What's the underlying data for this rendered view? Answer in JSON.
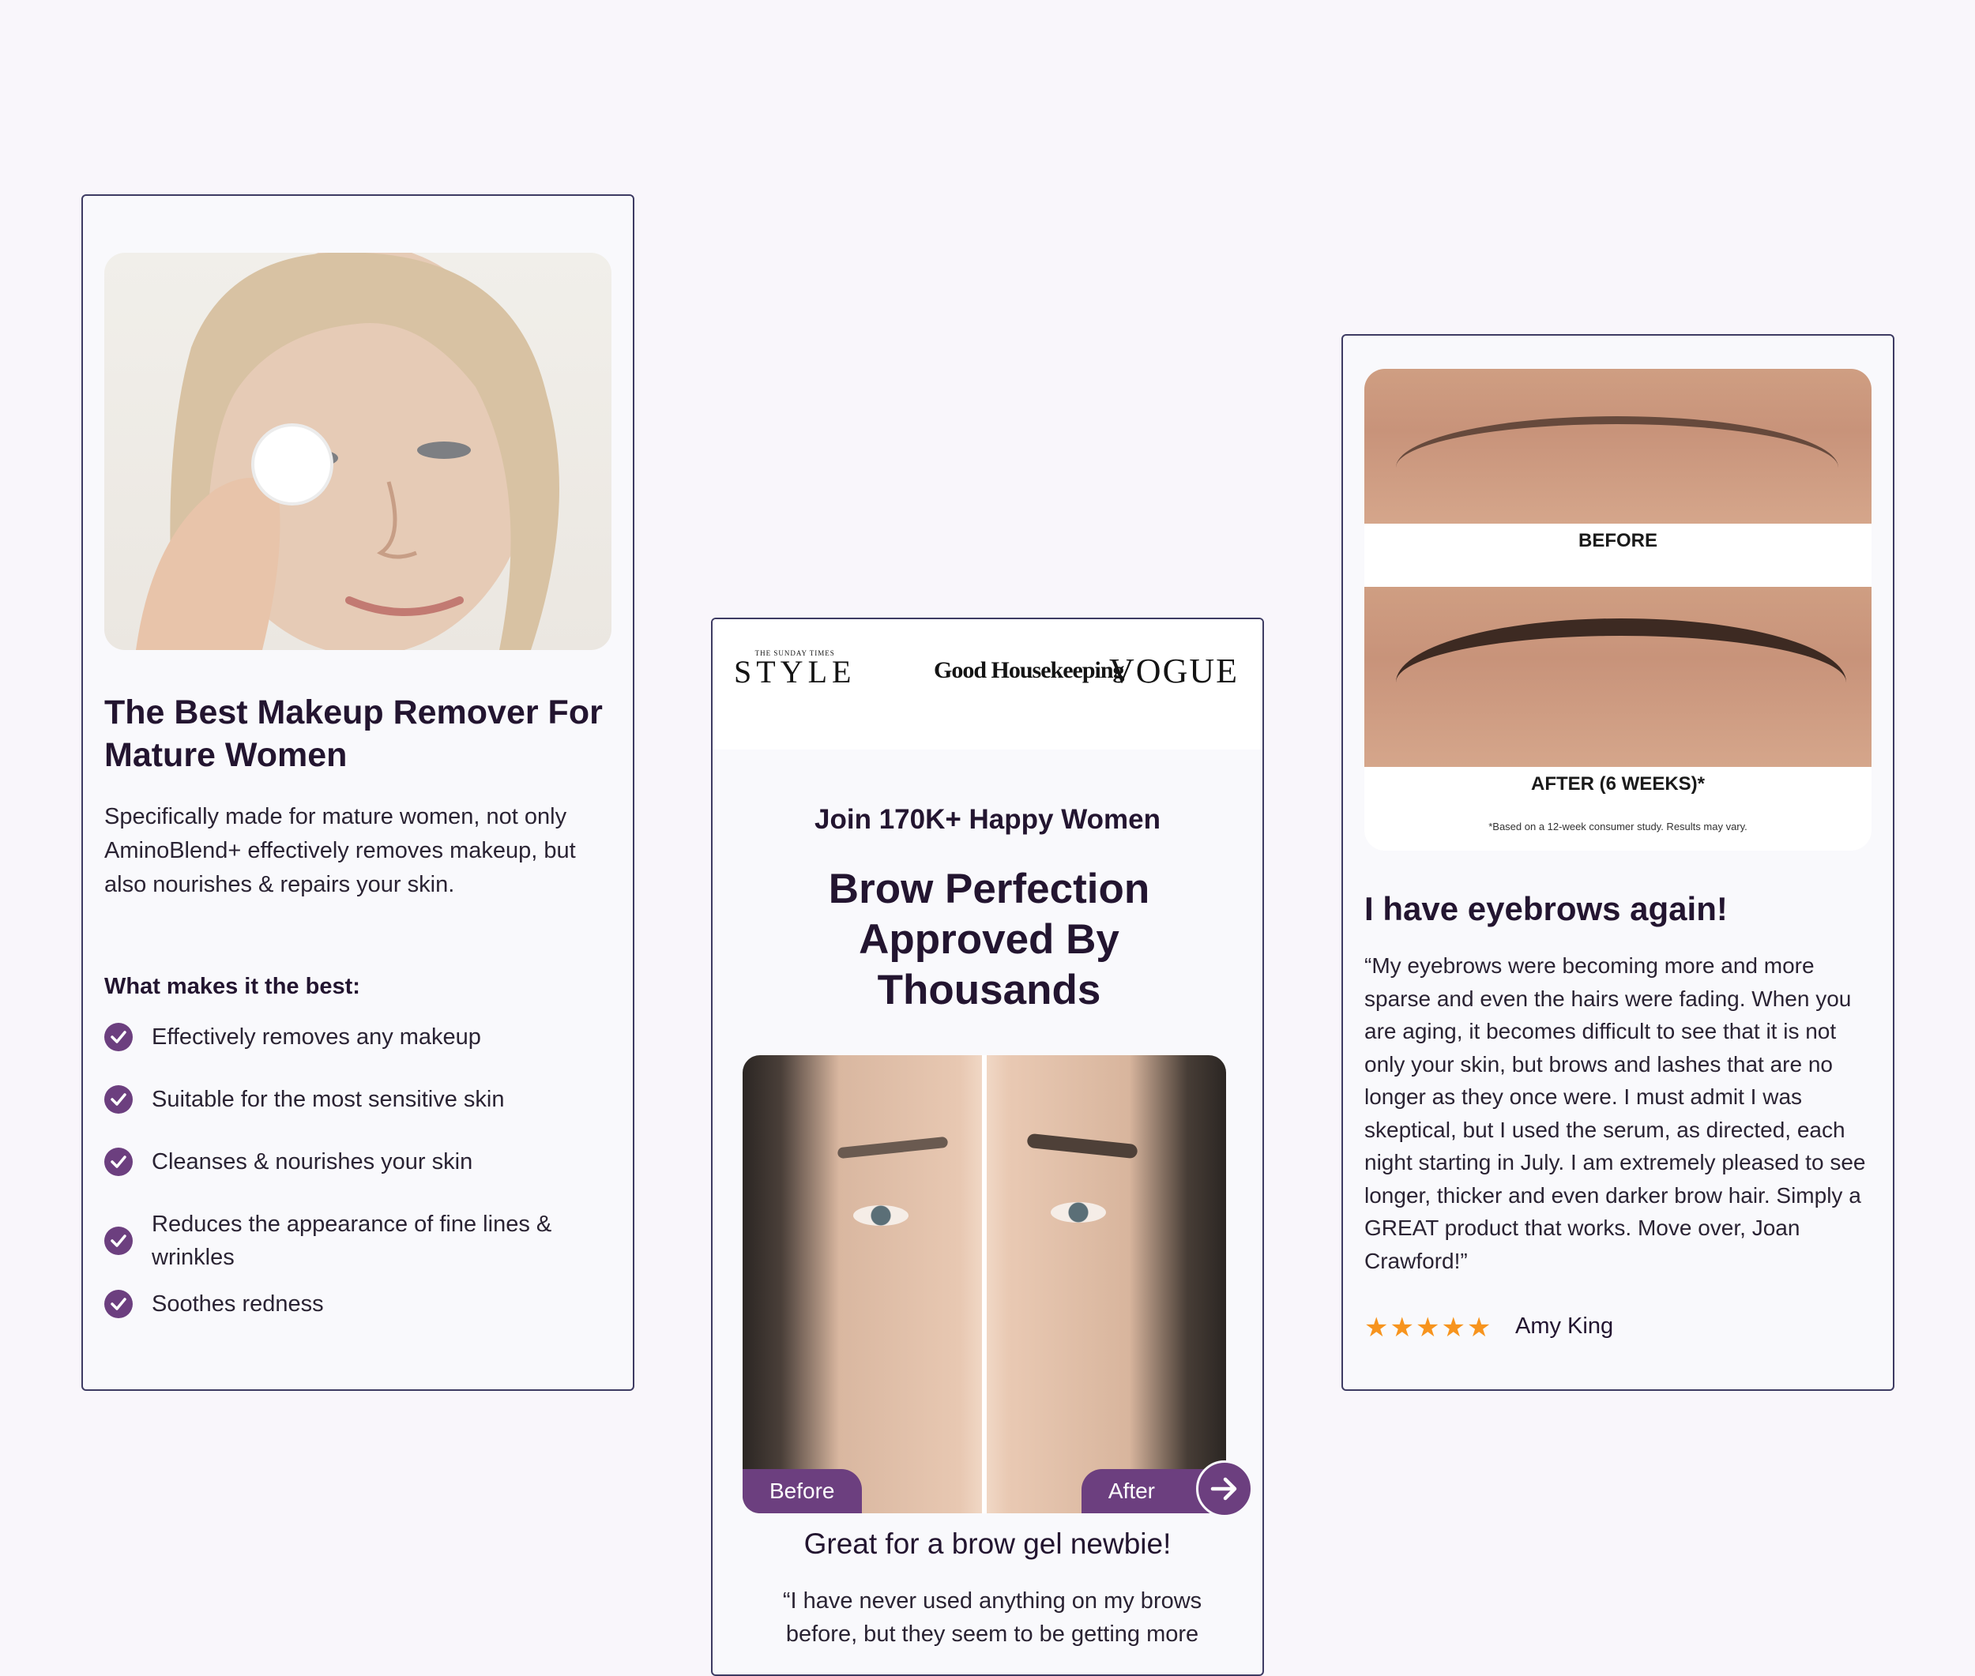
{
  "left_card": {
    "title": "The Best Makeup Remover For Mature Women",
    "description": "Specifically made for mature women, not only AminoBlend+ effectively removes makeup, but also nourishes & repairs your skin.",
    "subheading": "What makes it the best:",
    "features": [
      "Effectively removes any makeup",
      "Suitable for the most sensitive skin",
      "Cleanses & nourishes your skin",
      "Reduces the appearance of fine lines & wrinkles",
      "Soothes redness"
    ]
  },
  "middle_card": {
    "logos": {
      "style_small": "THE SUNDAY TIMES",
      "style_big": "STYLE",
      "good_housekeeping": "Good Housekeeping",
      "vogue": "VOGUE"
    },
    "kicker": "Join 170K+ Happy Women",
    "title": "Brow Perfection Approved By Thousands",
    "before_label": "Before",
    "after_label": "After",
    "review_title": "Great for a brow gel newbie!",
    "review_text": "“I have never used anything on my brows before, but they seem to be getting more"
  },
  "right_card": {
    "before_label": "BEFORE",
    "after_label": "AFTER (6 WEEKS)*",
    "footnote": "*Based on a 12-week consumer study. Results may vary.",
    "title": "I have eyebrows again!",
    "review_text": "“My eyebrows were becoming more and more sparse and even the hairs were fading. When you are aging, it becomes difficult to see that it is not only your skin, but brows and lashes that are no longer as they once were. I must admit I was skeptical, but I used the serum, as directed, each night starting in July. I am extremely pleased to see longer, thicker and even darker brow hair. Simply a GREAT product that works. Move over, Joan Crawford!”",
    "stars": "★★★★★",
    "rating": 5,
    "reviewer": "Amy King"
  },
  "colors": {
    "accent": "#6c3f7f",
    "star": "#f7941e",
    "border": "#3e3b63",
    "heading": "#231530"
  }
}
